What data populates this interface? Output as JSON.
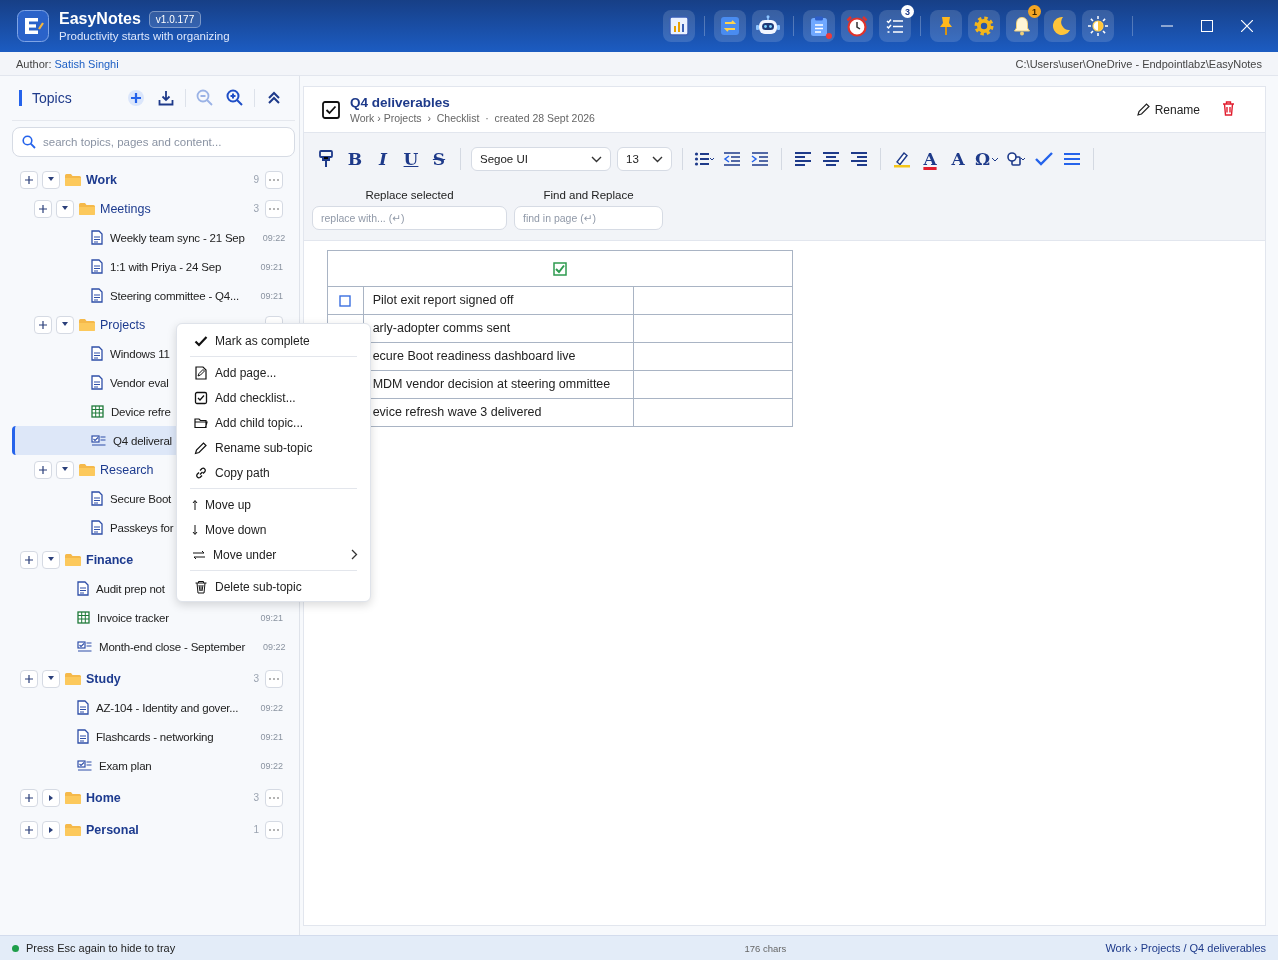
{
  "app": {
    "name": "EasyNotes",
    "version": "v1.0.177",
    "tagline": "Productivity starts with organizing"
  },
  "header_tools": [
    {
      "kind": "chart",
      "alert_dot": false
    },
    {
      "kind": "sep"
    },
    {
      "kind": "swap",
      "alert_dot": false
    },
    {
      "kind": "robot",
      "alert_dot": false
    },
    {
      "kind": "sep"
    },
    {
      "kind": "clipboard",
      "alert_dot": true
    },
    {
      "kind": "alarm",
      "alert_dot": false
    },
    {
      "kind": "tasks",
      "badge": "3",
      "alert_dot": false
    },
    {
      "kind": "sep"
    },
    {
      "kind": "pin",
      "alert_dot": false
    },
    {
      "kind": "gear",
      "alert_dot": false
    },
    {
      "kind": "bell",
      "badge": "1",
      "alert_dot": false
    },
    {
      "kind": "moon",
      "alert_dot": false
    },
    {
      "kind": "brightness",
      "alert_dot": false
    }
  ],
  "author_bar": {
    "label": "Author:",
    "name": "Satish Singhi",
    "path": "C:\\Users\\user\\OneDrive - Endpointlabz\\EasyNotes"
  },
  "sidebar": {
    "title": "Topics",
    "search": {
      "placeholder": "search topics, pages and content..."
    },
    "tree": [
      {
        "kind": "topic",
        "name": "Work",
        "count": "9",
        "expanded": true,
        "children": [
          {
            "kind": "topic",
            "name": "Meetings",
            "count": "3",
            "expanded": true,
            "children": [
              {
                "kind": "page",
                "title": "Weekly team sync - 21 Sep",
                "time": "09:22",
                "selected": false
              },
              {
                "kind": "page",
                "title": "1:1 with Priya - 24 Sep",
                "time": "09:21",
                "selected": false
              },
              {
                "kind": "page",
                "title": "Steering committee - Q4...",
                "time": "09:21",
                "selected": false
              }
            ]
          },
          {
            "kind": "topic",
            "name": "Projects",
            "expanded": true,
            "children": [
              {
                "kind": "page",
                "title": "Windows 11",
                "selected": false
              },
              {
                "kind": "page",
                "title": "Vendor eval",
                "selected": false
              },
              {
                "kind": "sheet",
                "title": "Device refre",
                "selected": false
              },
              {
                "kind": "checklist",
                "title": "Q4 deliveral",
                "selected": true
              }
            ]
          },
          {
            "kind": "topic",
            "name": "Research",
            "expanded": true,
            "children": [
              {
                "kind": "page",
                "title": "Secure Boot",
                "selected": false
              },
              {
                "kind": "page",
                "title": "Passkeys for",
                "selected": false
              }
            ]
          }
        ]
      },
      {
        "kind": "topic",
        "name": "Finance",
        "expanded": true,
        "children": [
          {
            "kind": "page",
            "title": "Audit prep not",
            "selected": false
          },
          {
            "kind": "sheet",
            "title": "Invoice tracker",
            "time": "09:21",
            "selected": false
          },
          {
            "kind": "checklist",
            "title": "Month-end close - September",
            "time": "09:22",
            "selected": false
          }
        ]
      },
      {
        "kind": "topic",
        "name": "Study",
        "count": "3",
        "expanded": true,
        "children": [
          {
            "kind": "page",
            "title": "AZ-104 - Identity and gover...",
            "time": "09:22",
            "selected": false
          },
          {
            "kind": "page",
            "title": "Flashcards - networking",
            "time": "09:21",
            "selected": false
          },
          {
            "kind": "checklist",
            "title": "Exam plan",
            "time": "09:22",
            "selected": false
          }
        ]
      },
      {
        "kind": "topic",
        "name": "Home",
        "count": "3",
        "expanded": false
      },
      {
        "kind": "topic",
        "name": "Personal",
        "count": "1",
        "expanded": false
      }
    ]
  },
  "context_menu": [
    {
      "kind": "check",
      "label": "Mark as complete",
      "submenu": false
    },
    {
      "kind": "sep"
    },
    {
      "kind": "page",
      "label": "Add page...",
      "submenu": false
    },
    {
      "kind": "checklist",
      "label": "Add checklist...",
      "submenu": false
    },
    {
      "kind": "folder",
      "label": "Add child topic...",
      "submenu": false
    },
    {
      "kind": "pencil",
      "label": "Rename sub-topic",
      "submenu": false
    },
    {
      "kind": "link",
      "label": "Copy path",
      "submenu": false
    },
    {
      "kind": "sep"
    },
    {
      "kind": "up",
      "label": "Move up",
      "submenu": false
    },
    {
      "kind": "down",
      "label": "Move down",
      "submenu": false
    },
    {
      "kind": "under",
      "label": "Move under",
      "submenu": true
    },
    {
      "kind": "sep"
    },
    {
      "kind": "trash",
      "label": "Delete sub-topic",
      "submenu": false
    }
  ],
  "editor": {
    "title": "Q4 deliverables",
    "breadcrumb": "Work › Projects  ›  Checklist  ·  created 28 Sept 2026",
    "rename_label": "Rename",
    "format_tools": [
      {
        "kind": "painter"
      },
      {
        "kind": "bold",
        "label": "B"
      },
      {
        "kind": "italic",
        "label": "I"
      },
      {
        "kind": "underline",
        "label": "U"
      },
      {
        "kind": "strike",
        "label": "S"
      },
      {
        "kind": "sep"
      },
      {
        "kind": "font",
        "value": "Segoe UI"
      },
      {
        "kind": "size",
        "value": "13"
      },
      {
        "kind": "sep"
      },
      {
        "kind": "bullets"
      },
      {
        "kind": "outdent"
      },
      {
        "kind": "indent"
      },
      {
        "kind": "sep"
      },
      {
        "kind": "align-left"
      },
      {
        "kind": "align-center"
      },
      {
        "kind": "align-right"
      },
      {
        "kind": "sep"
      },
      {
        "kind": "highlight"
      },
      {
        "kind": "font-color",
        "label": "A"
      },
      {
        "kind": "clear-format",
        "label": "A"
      },
      {
        "kind": "symbol",
        "label": "Ω"
      },
      {
        "kind": "shapes"
      },
      {
        "kind": "check"
      },
      {
        "kind": "lines"
      },
      {
        "kind": "sep"
      }
    ],
    "replace": {
      "label": "Replace selected",
      "placeholder": "replace with... (↵)"
    },
    "find": {
      "label": "Find and Replace",
      "placeholder": "find in page (↵)"
    },
    "checklist": {
      "all_checked": true,
      "rows": [
        {
          "text": "Pilot exit report signed off",
          "checked": false
        },
        {
          "text": "arly-adopter comms sent"
        },
        {
          "text": "ecure Boot readiness dashboard live"
        },
        {
          "text": "MDM vendor decision at steering ommittee"
        },
        {
          "text": "evice refresh wave 3 delivered"
        }
      ]
    }
  },
  "status_bar": {
    "message": "Press Esc again to hide to tray",
    "chars": "176 chars",
    "breadcrumb": "Work › Projects / Q4 deliverables"
  }
}
